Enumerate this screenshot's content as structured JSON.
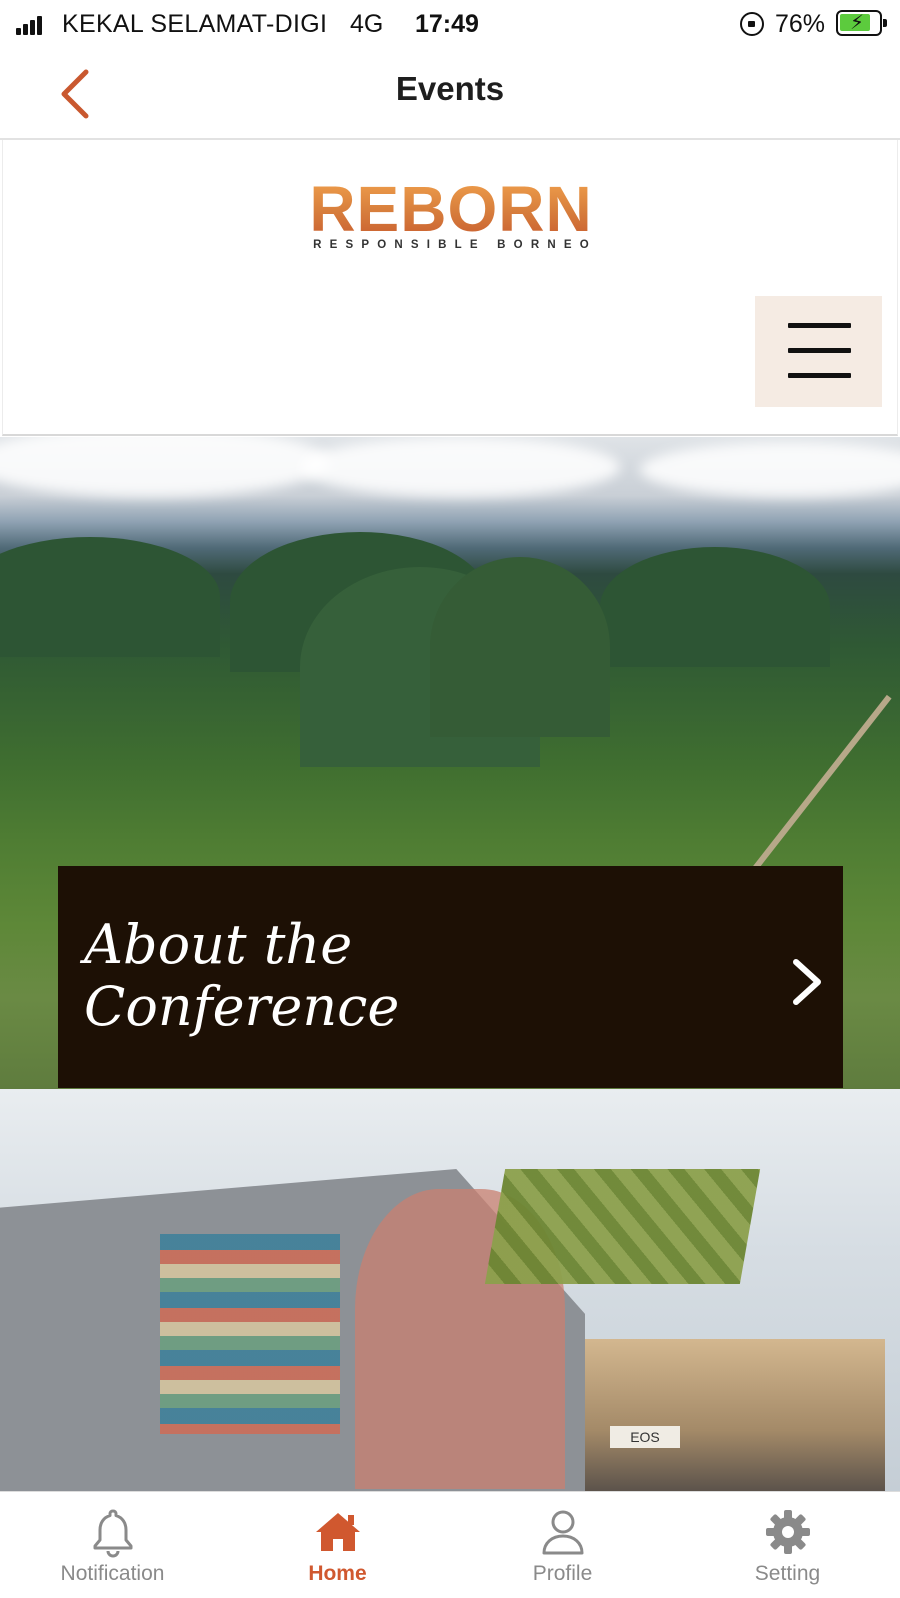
{
  "status_bar": {
    "carrier": "KEKAL SELAMAT-DIGI",
    "network": "4G",
    "time": "17:49",
    "battery": "76%",
    "battery_level": 0.76
  },
  "header": {
    "title": "Events",
    "back_icon": "chevron-left-icon"
  },
  "web": {
    "logo_text": "REBORN",
    "logo_tagline": "RESPONSIBLE BORNEO",
    "menu_icon": "hamburger-icon"
  },
  "hero": {
    "card_title_line1": "About the",
    "card_title_line2": "Conference",
    "card_icon": "chevron-right-icon"
  },
  "street": {
    "sign": "EOS"
  },
  "tabs": [
    {
      "label": "Notification",
      "icon": "bell-icon",
      "active": false
    },
    {
      "label": "Home",
      "icon": "home-icon",
      "active": true
    },
    {
      "label": "Profile",
      "icon": "user-icon",
      "active": false
    },
    {
      "label": "Setting",
      "icon": "gear-icon",
      "active": false
    }
  ],
  "colors": {
    "accent": "#d0582f",
    "card_bg": "#1d1005",
    "menu_bg": "#f5ebe3"
  }
}
